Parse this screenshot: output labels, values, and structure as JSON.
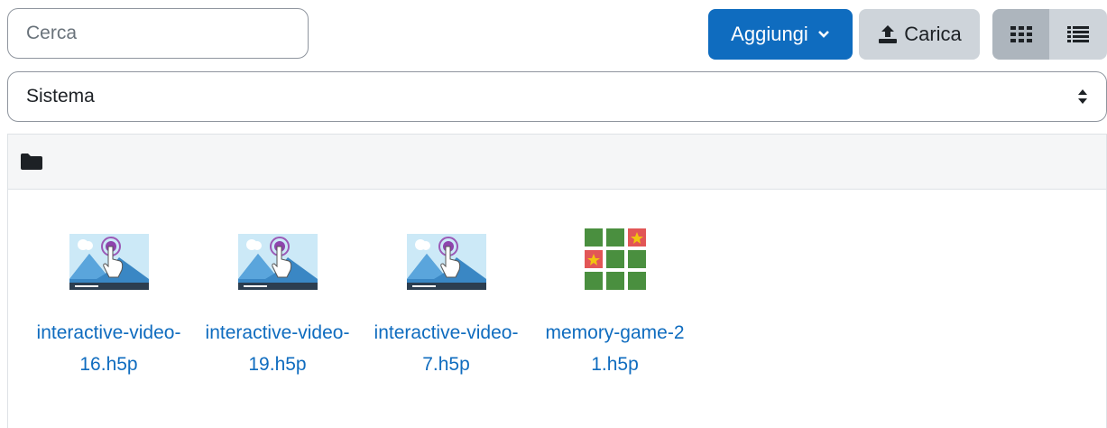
{
  "toolbar": {
    "search_placeholder": "Cerca",
    "add_label": "Aggiungi",
    "upload_label": "Carica"
  },
  "filter": {
    "selected": "Sistema"
  },
  "files": [
    {
      "name": "interactive-video-16.h5p",
      "icon": "interactive-video-icon"
    },
    {
      "name": "interactive-video-19.h5p",
      "icon": "interactive-video-icon"
    },
    {
      "name": "interactive-video-7.h5p",
      "icon": "interactive-video-icon"
    },
    {
      "name": "memory-game-21.h5p",
      "icon": "memory-game-icon"
    }
  ],
  "colors": {
    "primary": "#0f6cbf",
    "secondary": "#ced4da",
    "active_view": "#adb5bd"
  }
}
